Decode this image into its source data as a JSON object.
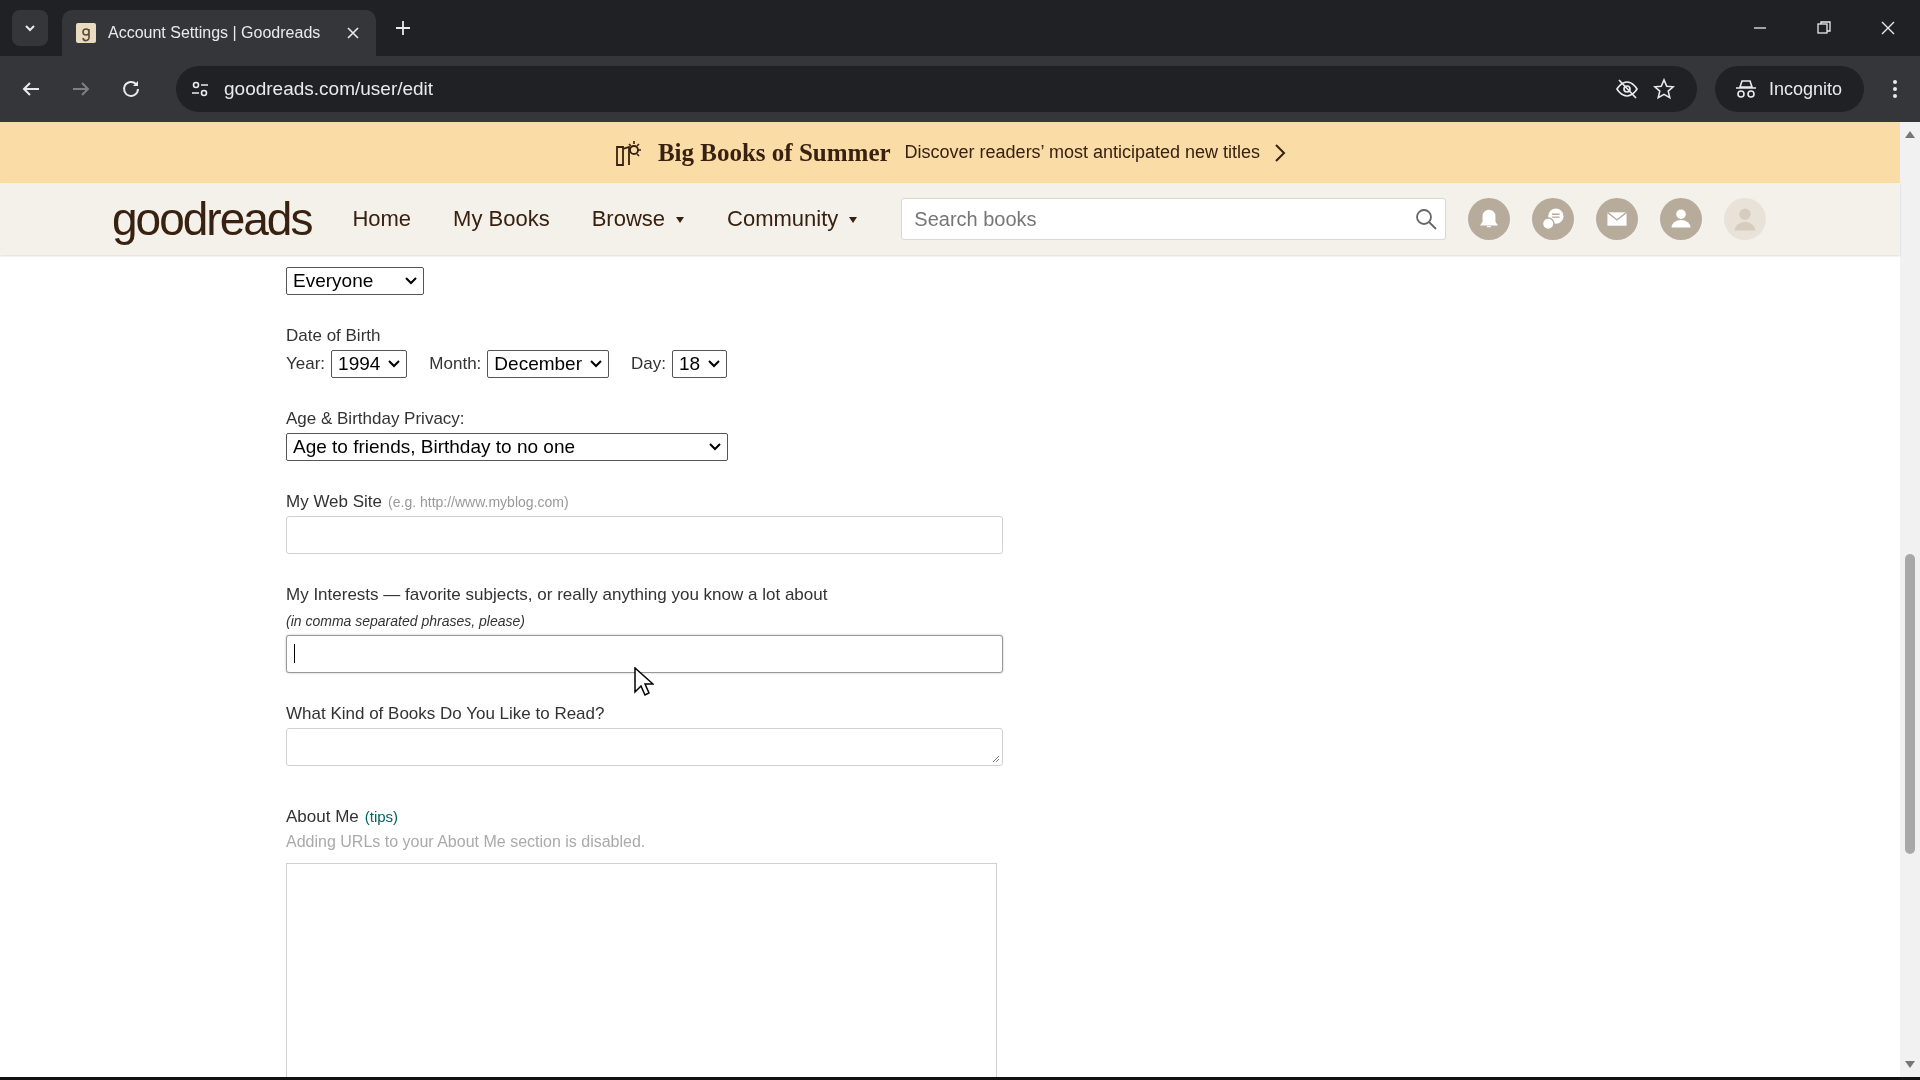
{
  "browser": {
    "tabs": [
      {
        "title": "Account Settings | Goodreads",
        "selected": true
      }
    ],
    "url": "goodreads.com/user/edit",
    "profile_label": "Incognito"
  },
  "banner": {
    "title": "Big Books of Summer",
    "text": "Discover readers’ most anticipated new titles"
  },
  "nav": {
    "logo": "goodreads",
    "items": [
      {
        "label": "Home",
        "dropdown": false
      },
      {
        "label": "My Books",
        "dropdown": false
      },
      {
        "label": "Browse",
        "dropdown": true
      },
      {
        "label": "Community",
        "dropdown": true
      }
    ],
    "search": {
      "placeholder": "Search books"
    }
  },
  "form": {
    "location_viewable": {
      "value": "Everyone"
    },
    "date_of_birth": {
      "label": "Date of Birth",
      "parts": [
        {
          "label": "Year:",
          "value": "1994"
        },
        {
          "label": "Month:",
          "value": "December"
        },
        {
          "label": "Day:",
          "value": "18"
        }
      ]
    },
    "privacy": {
      "label": "Age & Birthday Privacy:",
      "value": "Age to friends, Birthday to no one"
    },
    "website": {
      "label": "My Web Site",
      "hint": "(e.g. http://www.myblog.com)"
    },
    "interests": {
      "label": "My Interests — favorite subjects, or really anything you know a lot about",
      "hint": "(in comma separated phrases, please)",
      "focused": true
    },
    "books": {
      "label": "What Kind of Books Do You Like to Read?"
    },
    "about": {
      "label": "About Me",
      "link": "(tips)",
      "note": "Adding URLs to your About Me section is disabled."
    }
  }
}
